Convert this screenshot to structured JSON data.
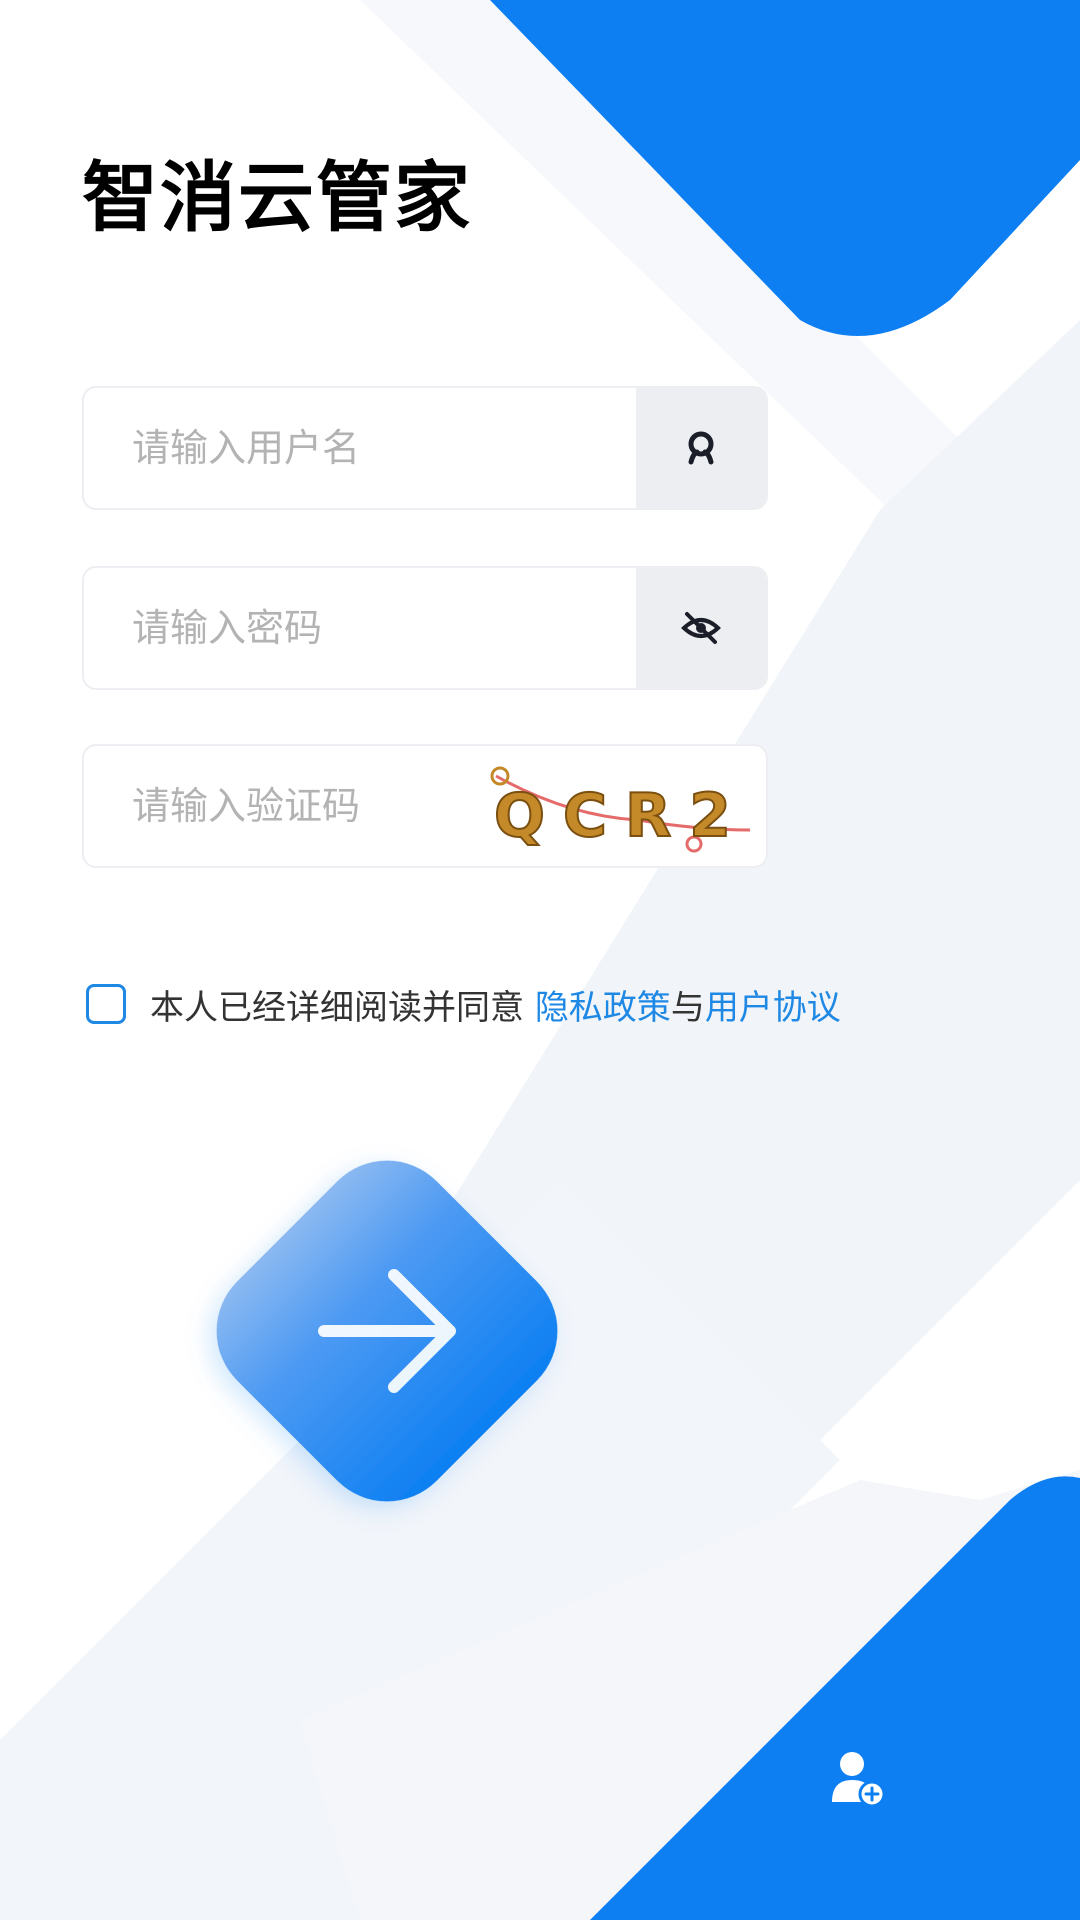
{
  "app": {
    "title": "智消云管家"
  },
  "login": {
    "username_placeholder": "请输入用户名",
    "password_placeholder": "请输入密码",
    "captcha_placeholder": "请输入验证码",
    "captcha_text": "QCR2"
  },
  "agreement": {
    "text": "本人已经详细阅读并同意",
    "privacy_link": "隐私政策",
    "conjunction": "与",
    "terms_link": "用户协议",
    "checked": false
  },
  "icons": {
    "username": "user-icon",
    "password": "eye-off-icon",
    "submit": "arrow-right-icon",
    "register": "add-user-icon"
  },
  "colors": {
    "brand": "#0d7ff2",
    "link": "#1e88e5",
    "field_bg": "#eceef2",
    "background_stripe": "#f1f4f9"
  }
}
